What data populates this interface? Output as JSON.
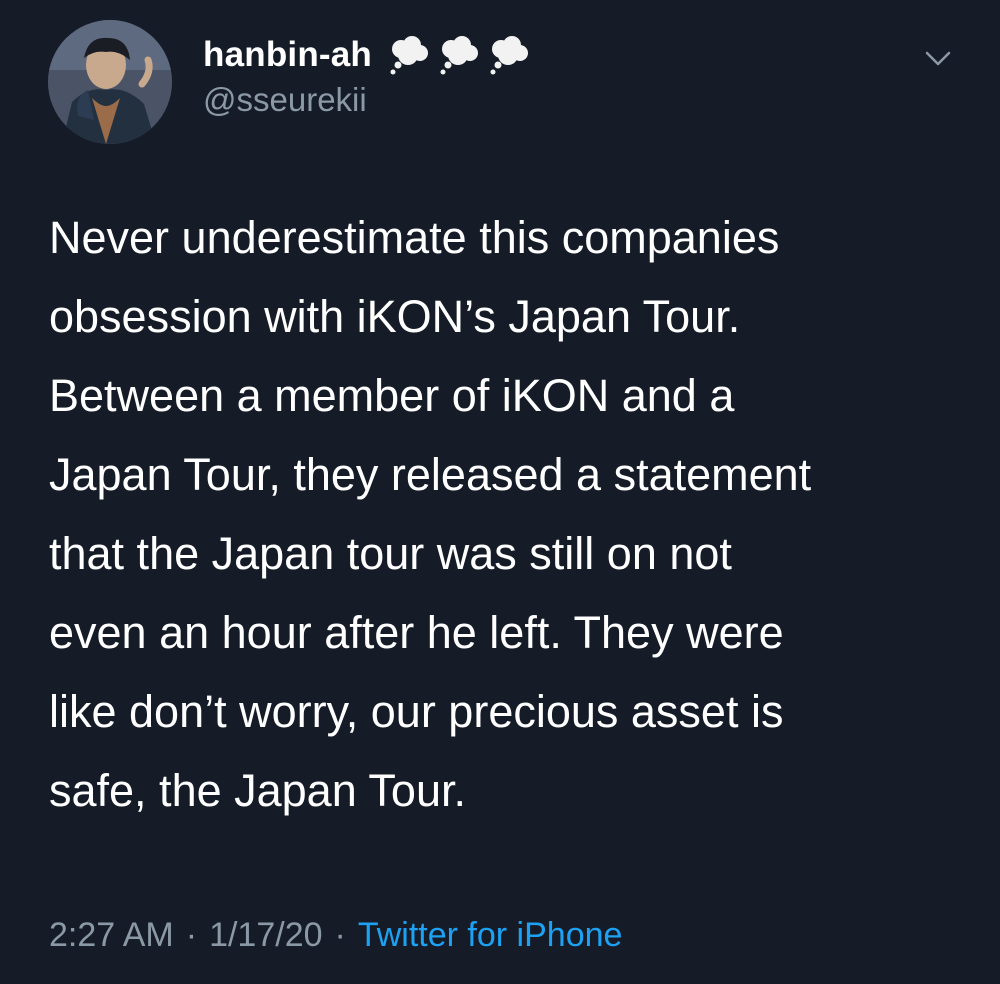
{
  "user": {
    "display_name": "hanbin-ah",
    "handle": "@sseurekii",
    "name_emojis": [
      "thought-balloon-icon",
      "thought-balloon-icon",
      "thought-balloon-icon"
    ]
  },
  "tweet": {
    "text": "Never underestimate this companies\nobsession with iKON’s Japan Tour.\nBetween a member of iKON and a\nJapan Tour, they released a statement\nthat the Japan tour was still on not\neven an hour after he left. They were\nlike don’t worry, our precious asset is\nsafe, the Japan Tour."
  },
  "meta": {
    "time": "2:27 AM",
    "date": "1/17/20",
    "separator": "·",
    "source": "Twitter for iPhone"
  },
  "colors": {
    "background": "#151c28",
    "primary_text": "#ffffff",
    "secondary_text": "#8b98a5",
    "link": "#1da1f2"
  }
}
